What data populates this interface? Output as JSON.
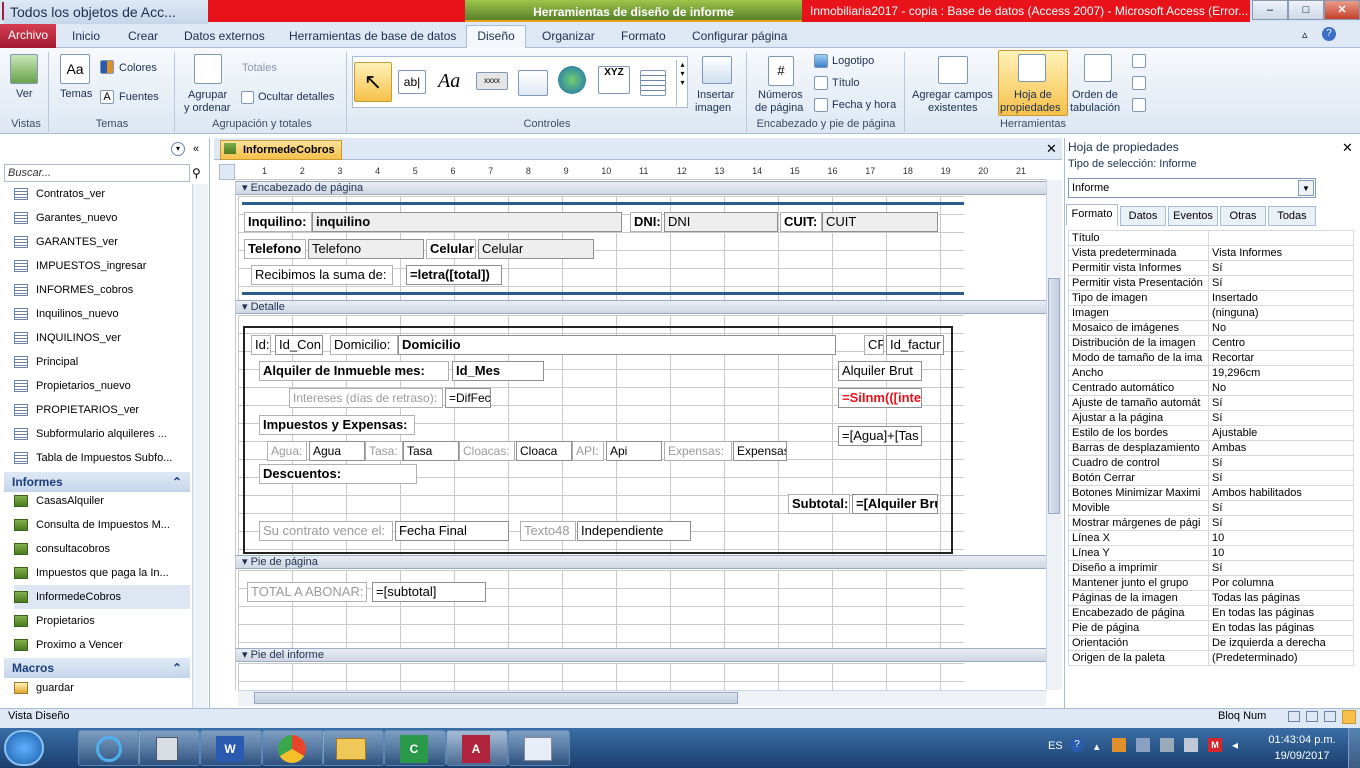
{
  "window": {
    "tools_title": "Herramientas de diseño de informe",
    "title": "Inmobiliaria2017 - copia : Base de datos (Access 2007) - Microsoft Access (Error...",
    "app_icon": "A",
    "minimize": "–",
    "maximize": "□",
    "close": "✕"
  },
  "tabs": {
    "archivo": "Archivo",
    "inicio": "Inicio",
    "crear": "Crear",
    "datos_externos": "Datos externos",
    "herramientas_bd": "Herramientas de base de datos",
    "diseno": "Diseño",
    "organizar": "Organizar",
    "formato": "Formato",
    "configurar": "Configurar página"
  },
  "ribbon": {
    "ver": "Ver",
    "temas": "Temas",
    "colores": "Colores",
    "fuentes": "Fuentes",
    "agrupar": "Agrupar",
    "y_ordenar": "y ordenar",
    "totales": "Totales",
    "ocultar": "Ocultar detalles",
    "insertar": "Insertar",
    "imagen": "imagen",
    "numeros": "Números",
    "de_pagina": "de página",
    "logotipo": "Logotipo",
    "titulo": "Título",
    "fecha_hora": "Fecha y hora",
    "agregar_campos": "Agregar campos",
    "existentes": "existentes",
    "hoja": "Hoja de",
    "propiedades": "propiedades",
    "orden": "Orden de",
    "tabulacion": "tabulación",
    "groups": {
      "vistas": "Vistas",
      "temas": "Temas",
      "agrupacion": "Agrupación y totales",
      "controles": "Controles",
      "encabezado": "Encabezado y pie de página",
      "herramientas": "Herramientas"
    },
    "gallery_xyz": "XYZ",
    "gallery_abl": "ab|",
    "gallery_aa": "Aa",
    "gallery_xxxx": "xxxx"
  },
  "nav": {
    "header": "Todos los objetos de Acc...",
    "search_placeholder": "Buscar...",
    "forms": [
      "Contratos_ver",
      "Garantes_nuevo",
      "GARANTES_ver",
      "IMPUESTOS_ingresar",
      "INFORMES_cobros",
      "Inquilinos_nuevo",
      "INQUILINOS_ver",
      "Principal",
      "Propietarios_nuevo",
      "PROPIETARIOS_ver",
      "Subformulario alquileres ...",
      "Tabla de Impuestos Subfo..."
    ],
    "informes_label": "Informes",
    "reports": [
      "CasasAlquiler",
      "Consulta de Impuestos M...",
      "consultacobros",
      "Impuestos que paga la In...",
      "InformedeCobros",
      "Propietarios",
      "Proximo a Vencer"
    ],
    "macros_label": "Macros",
    "macros": [
      "guardar"
    ]
  },
  "doc": {
    "tab": "InformedeCobros",
    "ruler_marks": [
      "1",
      "2",
      "3",
      "4",
      "5",
      "6",
      "7",
      "8",
      "9",
      "10",
      "11",
      "12",
      "13",
      "14",
      "15",
      "16",
      "17",
      "18",
      "19",
      "20",
      "21"
    ],
    "sections": {
      "encabezado": "Encabezado de página",
      "detalle": "Detalle",
      "pie": "Pie de página",
      "pie_informe": "Pie del informe"
    },
    "header_controls": {
      "inquilino_lbl": "Inquilino:",
      "inquilino_fld": "inquilino",
      "dni_lbl": "DNI:",
      "dni_fld": "DNI",
      "cuit_lbl": "CUIT:",
      "cuit_fld": "CUIT",
      "telefono_lbl": "Telefono",
      "telefono_fld": "Telefono",
      "celular_lbl": "Celular",
      "celular_fld": "Celular",
      "recibimos_lbl": "Recibimos la suma de:",
      "letra_fld": "=letra([total])"
    },
    "detail_controls": {
      "id_lbl": "Id:",
      "id_fld": "Id_Con",
      "domicilio_lbl": "Domicilio:",
      "domicilio_fld": "Domicilio",
      "cf_lbl": "CF",
      "factura_fld": "Id_factur",
      "alquiler_lbl": "Alquiler de Inmueble mes:",
      "mes_fld": "Id_Mes",
      "alquiler_bruto_fld": "Alquiler Brut",
      "intereses_lbl": "Intereses (días de retraso):",
      "difecha_fld": "=DifFecl",
      "siinm_fld": "=SiInm(([inte",
      "impuestos_lbl": "Impuestos y Expensas:",
      "agua_lbl": "Agua:",
      "agua_fld": "Agua",
      "tasa_lbl": "Tasa:",
      "tasa_fld": "Tasa",
      "cloacas_lbl": "Cloacas:",
      "cloaca_fld": "Cloaca",
      "api_lbl": "API:",
      "api_fld": "Api",
      "expensas_lbl": "Expensas:",
      "expensas_fld": "Expensas",
      "suma_fld": "=[Agua]+[Tas",
      "descuentos_lbl": "Descuentos:",
      "subtotal_lbl": "Subtotal:",
      "subtotal_fld": "=[Alquiler Bru",
      "vence_lbl": "Su contrato vence el:",
      "fecha_final_fld": "Fecha Final",
      "texto48_lbl": "Texto48",
      "independiente_fld": "Independiente"
    },
    "footer_controls": {
      "total_lbl": "TOTAL A ABONAR:",
      "total_fld": "=[subtotal]"
    }
  },
  "props": {
    "title": "Hoja de propiedades",
    "seltype": "Tipo de selección:  Informe",
    "selected": "Informe",
    "tabs": [
      "Formato",
      "Datos",
      "Eventos",
      "Otras",
      "Todas"
    ],
    "rows": [
      [
        "Título",
        ""
      ],
      [
        "Vista predeterminada",
        "Vista Informes"
      ],
      [
        "Permitir vista Informes",
        "Sí"
      ],
      [
        "Permitir vista Presentación",
        "Sí"
      ],
      [
        "Tipo de imagen",
        "Insertado"
      ],
      [
        "Imagen",
        "(ninguna)"
      ],
      [
        "Mosaico de imágenes",
        "No"
      ],
      [
        "Distribución de la imagen",
        "Centro"
      ],
      [
        "Modo de tamaño de la ima",
        "Recortar"
      ],
      [
        "Ancho",
        "19,296cm"
      ],
      [
        "Centrado automático",
        "No"
      ],
      [
        "Ajuste de tamaño automát",
        "Sí"
      ],
      [
        "Ajustar a la página",
        "Sí"
      ],
      [
        "Estilo de los bordes",
        "Ajustable"
      ],
      [
        "Barras de desplazamiento",
        "Ambas"
      ],
      [
        "Cuadro de control",
        "Sí"
      ],
      [
        "Botón Cerrar",
        "Sí"
      ],
      [
        "Botones Minimizar Maximi",
        "Ambos habilitados"
      ],
      [
        "Movible",
        "Sí"
      ],
      [
        "Mostrar márgenes de pági",
        "Sí"
      ],
      [
        "Línea X",
        "10"
      ],
      [
        "Línea Y",
        "10"
      ],
      [
        "Diseño a imprimir",
        "Sí"
      ],
      [
        "Mantener junto el grupo",
        "Por columna"
      ],
      [
        "Páginas de la imagen",
        "Todas las páginas"
      ],
      [
        "Encabezado de página",
        "En todas las páginas"
      ],
      [
        "Pie de página",
        "En todas las páginas"
      ],
      [
        "Orientación",
        "De izquierda a derecha"
      ],
      [
        "Origen de la paleta",
        "(Predeterminado)"
      ]
    ]
  },
  "status": {
    "left": "Vista Diseño",
    "right": "Bloq Num"
  },
  "taskbar": {
    "lang": "ES",
    "time": "01:43:04 p.m.",
    "date": "19/09/2017"
  },
  "colors": {
    "title_red": "#e8121a",
    "tools_green": "#58812a",
    "accent_blue": "#1c3f7a"
  }
}
